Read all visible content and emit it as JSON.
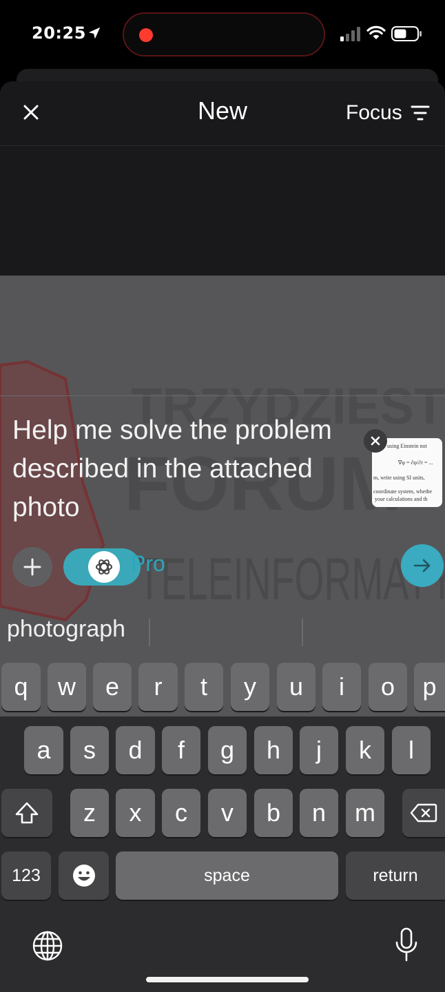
{
  "status_bar": {
    "time": "20:25",
    "location_icon": "location-arrow-icon",
    "recording_indicator_color": "#ff3b30",
    "signal_icon": "cellular-signal-icon",
    "wifi_icon": "wifi-icon",
    "battery_icon": "battery-icon"
  },
  "header": {
    "close_icon": "close-icon",
    "title": "New",
    "focus_label": "Focus",
    "focus_icon": "filter-lines-icon"
  },
  "background_watermark": {
    "line1": "TRZYDZIEST",
    "line2": "FORUM",
    "line3": "TELEINFORMATY"
  },
  "composer": {
    "prompt": "Help me solve the problem described in the attached photo",
    "attachment": {
      "remove_icon": "close-icon",
      "lines": [
        "using Einstein not",
        "∇φ = ∂φ/∂r = ...",
        "m, write using SI units,",
        "coordinate system, whethe",
        "your calculations and th"
      ]
    },
    "add_icon": "plus-icon",
    "model_toggle_label": "Pro",
    "model_icon": "openai-logo-icon",
    "send_icon": "arrow-right-icon",
    "accent_color": "#3aabc1"
  },
  "suggestions": [
    "photograph",
    "",
    ""
  ],
  "keyboard": {
    "row1": [
      "q",
      "w",
      "e",
      "r",
      "t",
      "y",
      "u",
      "i",
      "o",
      "p"
    ],
    "row2": [
      "a",
      "s",
      "d",
      "f",
      "g",
      "h",
      "j",
      "k",
      "l"
    ],
    "row3": [
      "z",
      "x",
      "c",
      "v",
      "b",
      "n",
      "m"
    ],
    "numbers_label": "123",
    "space_label": "space",
    "return_label": "return",
    "shift_icon": "shift-icon",
    "backspace_icon": "backspace-icon",
    "emoji_icon": "emoji-icon",
    "globe_icon": "globe-icon",
    "mic_icon": "microphone-icon"
  }
}
